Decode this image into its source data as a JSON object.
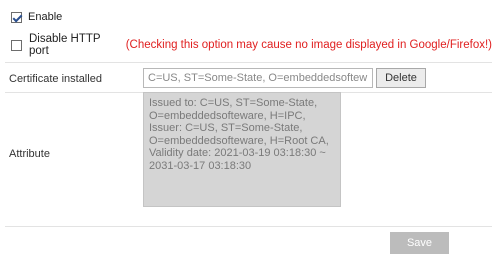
{
  "enable": {
    "label": "Enable",
    "checked": true
  },
  "disable_http": {
    "label": "Disable HTTP port",
    "checked": false,
    "warning": "(Checking this option may cause no image displayed in Google/Firefox!)"
  },
  "certificate": {
    "label": "Certificate installed",
    "value": "C=US, ST=Some-State, O=embeddedsoftew",
    "delete_label": "Delete"
  },
  "attribute": {
    "label": "Attribute",
    "lines": [
      "Issued to: C=US, ST=Some-State,",
      "O=embeddedsofteware, H=IPC,",
      "Issuer: C=US, ST=Some-State,",
      "O=embeddedsofteware, H=Root CA,",
      "Validity date: 2021-03-19 03:18:30 ~",
      "2031-03-17 03:18:30"
    ]
  },
  "save_label": "Save",
  "colors": {
    "warning": "#e02020",
    "save_button": "#bcbcbc",
    "attribute_bg": "#d5d5d5"
  }
}
